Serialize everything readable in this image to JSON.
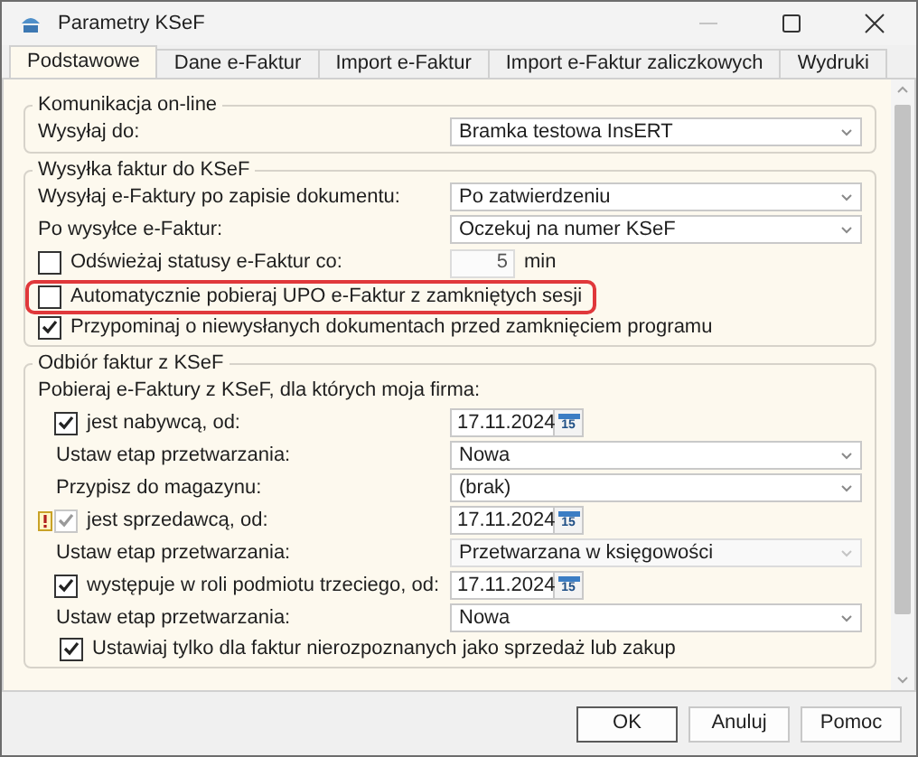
{
  "window": {
    "title": "Parametry KSeF"
  },
  "tabs": [
    {
      "label": "Podstawowe",
      "selected": true
    },
    {
      "label": "Dane e-Faktur",
      "selected": false
    },
    {
      "label": "Import e-Faktur",
      "selected": false
    },
    {
      "label": "Import e-Faktur zaliczkowych",
      "selected": false
    },
    {
      "label": "Wydruki",
      "selected": false
    }
  ],
  "groups": [
    {
      "title": "Komunikacja on-line",
      "rows": [
        {
          "kind": "select",
          "label": "Wysyłaj do:",
          "value": "Bramka testowa InsERT",
          "disabled": false
        }
      ]
    },
    {
      "title": "Wysyłka faktur do KSeF",
      "rows": [
        {
          "kind": "select",
          "label": "Wysyłaj e-Faktury po zapisie dokumentu:",
          "value": "Po zatwierdzeniu",
          "disabled": false
        },
        {
          "kind": "select",
          "label": "Po wysyłce e-Faktur:",
          "value": "Oczekuj na numer KSeF",
          "disabled": false
        },
        {
          "kind": "check_number",
          "label": "Odświeżaj statusy e-Faktur co:",
          "checked": false,
          "value": "5",
          "unit": "min"
        },
        {
          "kind": "check",
          "label": "Automatycznie pobieraj UPO e-Faktur z zamkniętych sesji",
          "checked": false,
          "highlighted": true
        },
        {
          "kind": "check",
          "label": "Przypominaj o niewysłanych dokumentach przed zamknięciem programu",
          "checked": true,
          "highlighted": false
        }
      ]
    },
    {
      "title": "Odbiór faktur z KSeF",
      "rows": [
        {
          "kind": "text",
          "label": "Pobieraj e-Faktury z KSeF, dla których moja firma:"
        },
        {
          "kind": "check_date",
          "label": "jest nabywcą, od:",
          "checked": true,
          "disabled": false,
          "warning": false,
          "value": "17.11.2024",
          "calendar_day": "15",
          "children": [
            {
              "kind": "select",
              "label": "Ustaw etap przetwarzania:",
              "value": "Nowa",
              "disabled": false
            },
            {
              "kind": "select",
              "label": "Przypisz do magazynu:",
              "value": "(brak)",
              "disabled": false
            }
          ]
        },
        {
          "kind": "check_date",
          "label": "jest sprzedawcą, od:",
          "checked": true,
          "disabled": true,
          "warning": true,
          "value": "17.11.2024",
          "calendar_day": "15",
          "children": [
            {
              "kind": "select",
              "label": "Ustaw etap przetwarzania:",
              "value": "Przetwarzana w księgowości",
              "disabled": true
            }
          ]
        },
        {
          "kind": "check_date",
          "label": "występuje w roli podmiotu trzeciego, od:",
          "checked": true,
          "disabled": false,
          "warning": false,
          "value": "17.11.2024",
          "calendar_day": "15",
          "children": [
            {
              "kind": "select",
              "label": "Ustaw etap przetwarzania:",
              "value": "Nowa",
              "disabled": false
            },
            {
              "kind": "check",
              "label": "Ustawiaj tylko dla faktur nierozpoznanych jako sprzedaż lub zakup",
              "checked": true,
              "highlighted": false
            }
          ]
        }
      ]
    }
  ],
  "buttons": [
    "OK",
    "Anuluj",
    "Pomoc"
  ]
}
